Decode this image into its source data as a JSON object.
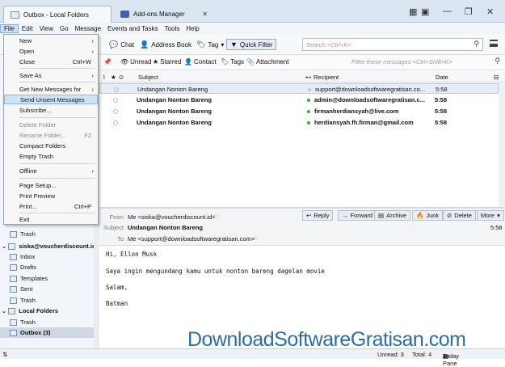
{
  "tabs": [
    {
      "label": "Outbox - Local Folders"
    },
    {
      "label": "Add-ons Manager"
    }
  ],
  "menubar": [
    "File",
    "Edit",
    "View",
    "Go",
    "Message",
    "Events and Tasks",
    "Tools",
    "Help"
  ],
  "toolbar": {
    "chat": "Chat",
    "address_book": "Address Book",
    "tag": "Tag",
    "quick_filter": "Quick Filter",
    "search_placeholder": "Search <Ctrl+K>"
  },
  "filterbar": {
    "unread": "Unread",
    "starred": "Starred",
    "contact": "Contact",
    "tags": "Tags",
    "attachment": "Attachment",
    "filter_placeholder": "Filter these messages <Ctrl+Shift+K>"
  },
  "file_menu": [
    {
      "label": "New",
      "arrow": "›"
    },
    {
      "label": "Open",
      "arrow": "›"
    },
    {
      "label": "Close",
      "shortcut": "Ctrl+W"
    },
    {
      "label": "Save As",
      "arrow": "›"
    },
    {
      "label": "Get New Messages for",
      "arrow": "›"
    },
    {
      "label": "Send Unsent Messages"
    },
    {
      "label": "Subscribe..."
    },
    {
      "label": "Delete Folder"
    },
    {
      "label": "Rename Folder...",
      "shortcut": "F2"
    },
    {
      "label": "Compact Folders"
    },
    {
      "label": "Empty Trash"
    },
    {
      "label": "Offline",
      "arrow": "›"
    },
    {
      "label": "Page Setup..."
    },
    {
      "label": "Print Preview"
    },
    {
      "label": "Print...",
      "shortcut": "Ctrl+P"
    },
    {
      "label": "Exit"
    }
  ],
  "sidebar": {
    "trash1": "Trash",
    "account": "siska@voucherdiscount.id",
    "inbox": "Inbox",
    "drafts": "Drafts",
    "templates": "Templates",
    "sent": "Sent",
    "trash2": "Trash",
    "local": "Local Folders",
    "trash3": "Trash",
    "outbox": "Outbox (3)"
  },
  "columns": {
    "subject": "Subject",
    "recipient": "Recipient",
    "date": "Date"
  },
  "messages": [
    {
      "subject": "Undangan Nonton Bareng",
      "recipient": "support@downloadsoftwaregratisan.co...",
      "date": "5:58"
    },
    {
      "subject": "Undangan Nonton Bareng",
      "recipient": "admin@downloadsoftwaregratisan.c...",
      "date": "5:58"
    },
    {
      "subject": "Undangan Nonton Bareng",
      "recipient": "firmanherdiansyah@live.com",
      "date": "5:58"
    },
    {
      "subject": "Undangan Nonton Bareng",
      "recipient": "herdiansyah.fh.firman@gmail.com",
      "date": "5:58"
    }
  ],
  "header_pane": {
    "from_label": "From",
    "from": "Me <siska@voucherdiscount.id>",
    "subject_label": "Subject",
    "subject": "Undangan Nonton Bareng",
    "time": "5:58",
    "to_label": "To",
    "to": "Me <support@downloadsoftwaregratisan.com>",
    "reply": "Reply",
    "forward": "Forward",
    "archive": "Archive",
    "junk": "Junk",
    "delete": "Delete",
    "more": "More"
  },
  "body": [
    "Hi, Ellon Musk",
    "Saya ingin mengundang kamu untuk nonton bareng dagelan movie",
    "Salam,",
    "Batman"
  ],
  "status": {
    "unread": "Unread: 3",
    "total": "Total: 4",
    "today": "Today Pane"
  },
  "watermark": "DownloadSoftwareGratisan.com"
}
